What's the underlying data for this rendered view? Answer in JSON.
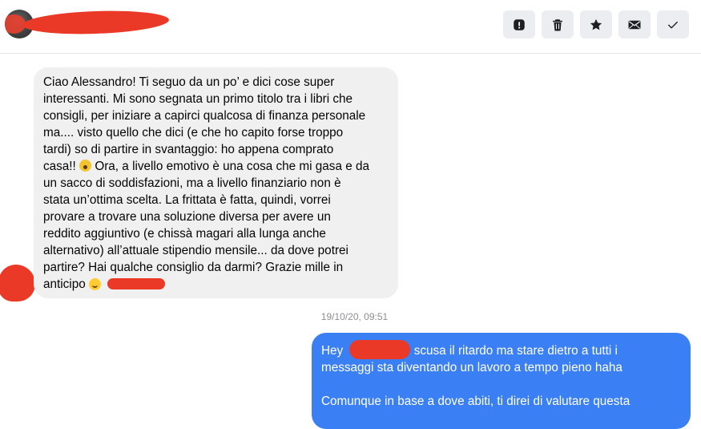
{
  "header": {
    "contact_name": "",
    "actions": [
      {
        "name": "report-button",
        "icon": "exclamation-icon"
      },
      {
        "name": "delete-button",
        "icon": "trash-icon"
      },
      {
        "name": "star-button",
        "icon": "star-icon"
      },
      {
        "name": "mark-unread-button",
        "icon": "envelope-icon"
      },
      {
        "name": "done-button",
        "icon": "checkmark-icon"
      }
    ]
  },
  "incoming": {
    "lines": [
      "Ciao Alessandro! Ti seguo da un po’ e dici cose super",
      "interessanti. Mi sono segnata un primo titolo tra i libri che",
      "consigli, per iniziare a capirci qualcosa di finanza personale",
      "ma.... visto quello che dici (e che ho capito forse troppo",
      "tardi) so di partire in svantaggio: ho appena comprato",
      "Ora, a livello emotivo è una cosa che mi gasa e da",
      "un sacco di soddisfazioni, ma a livello finanziario non è",
      "stata un’ottima scelta. La frittata è fatta, quindi, vorrei",
      "provare a trovare una soluzione diversa per avere un",
      "reddito aggiuntivo (e chissà magari alla lunga anche",
      "alternativo) all’attuale stipendio mensile... da dove potrei",
      "partire? Hai qualche consiglio da darmi?  Grazie mille in",
      "anticipo"
    ],
    "line6_prefix": "casa!!"
  },
  "timestamp": "19/10/20, 09:51",
  "outgoing": {
    "line1_prefix": "Hey",
    "line1_suffix": "scusa il ritardo ma stare dietro a tutti i",
    "line2": "messaggi sta diventando un lavoro a tempo pieno haha",
    "line4": "Comunque in base a dove abiti, ti direi di valutare questa"
  },
  "colors": {
    "incoming_bubble": "#f0f0f0",
    "outgoing_bubble": "#3b7ff5",
    "redaction": "#ea3a27",
    "action_button": "#ebedf0"
  }
}
